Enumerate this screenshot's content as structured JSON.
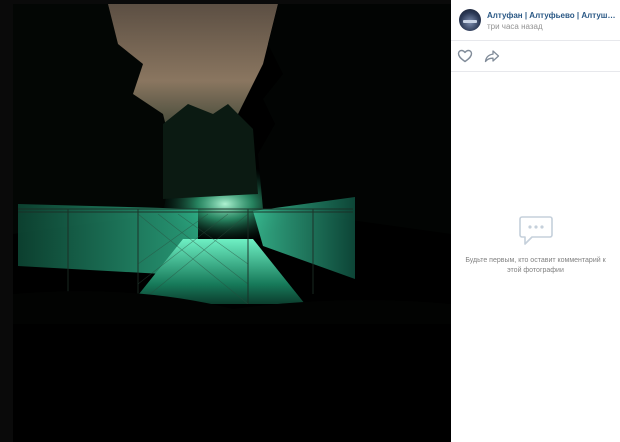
{
  "post": {
    "group_name": "Алтуфан | Алтуфьево | Алтушка, пр...",
    "time": "три часа назад"
  },
  "icons": {
    "like": "heart-icon",
    "share": "share-arrow-icon",
    "comments_empty": "comment-bubble-icon"
  },
  "comments": {
    "empty_text": "Будьте первым, кто оставит комментарий к этой фотографии"
  },
  "colors": {
    "link": "#2a5885",
    "muted": "#939393",
    "glow": "#4ee6b0"
  }
}
